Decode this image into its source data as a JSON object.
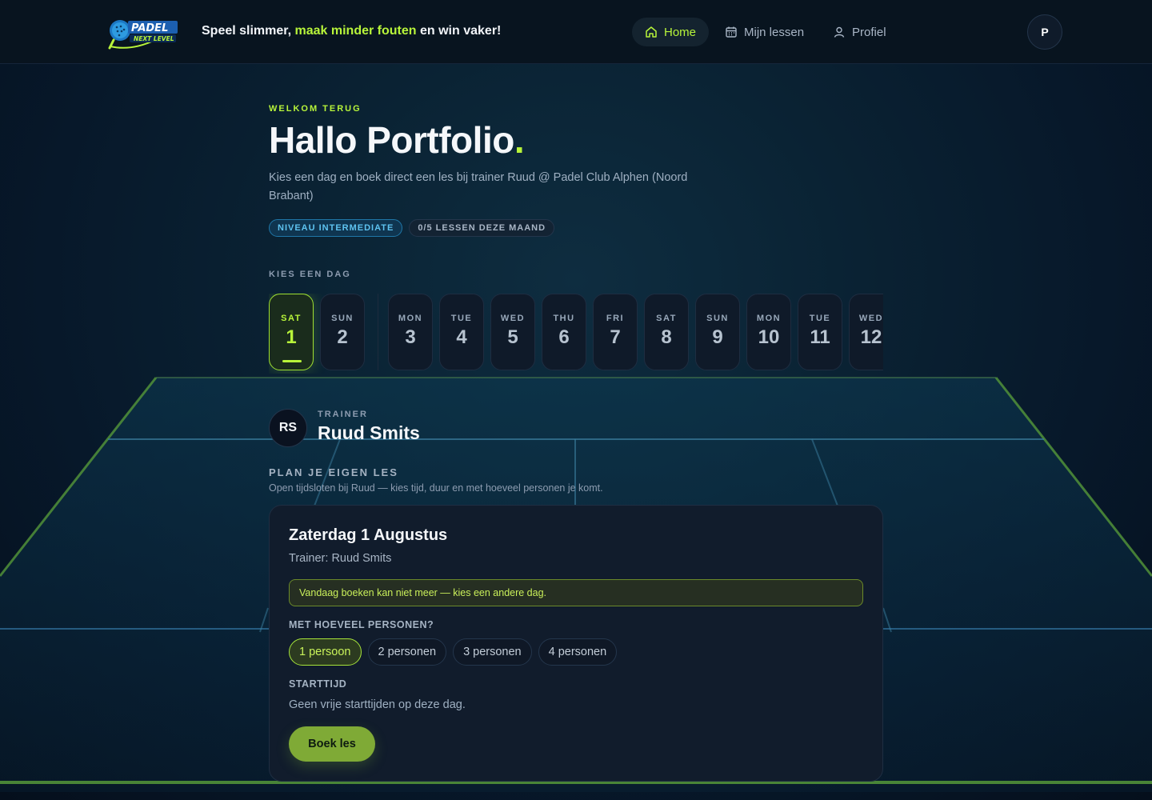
{
  "header": {
    "logo_text_top": "PADEL",
    "logo_text_bottom": "NEXT LEVEL",
    "tagline_start": "Speel slimmer, ",
    "tagline_highlight": "maak minder fouten",
    "tagline_end": " en win vaker!",
    "nav": [
      {
        "label": "Home",
        "icon": "home-icon",
        "active": true
      },
      {
        "label": "Mijn lessen",
        "icon": "calendar-icon",
        "active": false
      },
      {
        "label": "Profiel",
        "icon": "user-icon",
        "active": false
      }
    ],
    "avatar_initial": "P"
  },
  "welcome": {
    "eyebrow": "WELKOM TERUG",
    "title": "Hallo Portfolio",
    "title_dot": ".",
    "intro": "Kies een dag en boek direct een les bij trainer Ruud @ Padel Club Alphen (Noord Brabant)",
    "badge_level": "NIVEAU INTERMEDIATE",
    "badge_count": "0/5 LESSEN DEZE MAAND"
  },
  "day_picker": {
    "label": "KIES EEN DAG",
    "days": [
      {
        "dow": "SAT",
        "num": "1",
        "active": true
      },
      {
        "dow": "SUN",
        "num": "2",
        "active": false
      },
      {
        "dow": "MON",
        "num": "3",
        "active": false
      },
      {
        "dow": "TUE",
        "num": "4",
        "active": false
      },
      {
        "dow": "WED",
        "num": "5",
        "active": false
      },
      {
        "dow": "THU",
        "num": "6",
        "active": false
      },
      {
        "dow": "FRI",
        "num": "7",
        "active": false
      },
      {
        "dow": "SAT",
        "num": "8",
        "active": false
      },
      {
        "dow": "SUN",
        "num": "9",
        "active": false
      },
      {
        "dow": "MON",
        "num": "10",
        "active": false
      },
      {
        "dow": "TUE",
        "num": "11",
        "active": false
      },
      {
        "dow": "WED",
        "num": "12",
        "active": false
      }
    ]
  },
  "trainer": {
    "initials": "RS",
    "label": "TRAINER",
    "name": "Ruud Smits"
  },
  "plan": {
    "title": "PLAN JE EIGEN LES",
    "subtitle": "Open tijdsloten bij Ruud — kies tijd, duur en met hoeveel personen je komt."
  },
  "booking_card": {
    "title": "Zaterdag 1 Augustus",
    "trainer_line": "Trainer: Ruud Smits",
    "notice": "Vandaag boeken kan niet meer — kies een andere dag.",
    "persons_label": "MET HOEVEEL PERSONEN?",
    "persons": [
      {
        "label": "1 persoon",
        "active": true
      },
      {
        "label": "2 personen",
        "active": false
      },
      {
        "label": "3 personen",
        "active": false
      },
      {
        "label": "4 personen",
        "active": false
      }
    ],
    "start_label": "STARTTIJD",
    "no_slots": "Geen vrije starttijden op deze dag.",
    "book_button": "Boek les"
  },
  "colors": {
    "accent": "#b8f53a",
    "background": "#061420",
    "card": "#111c2c",
    "level_badge": "#5ec3f0"
  }
}
